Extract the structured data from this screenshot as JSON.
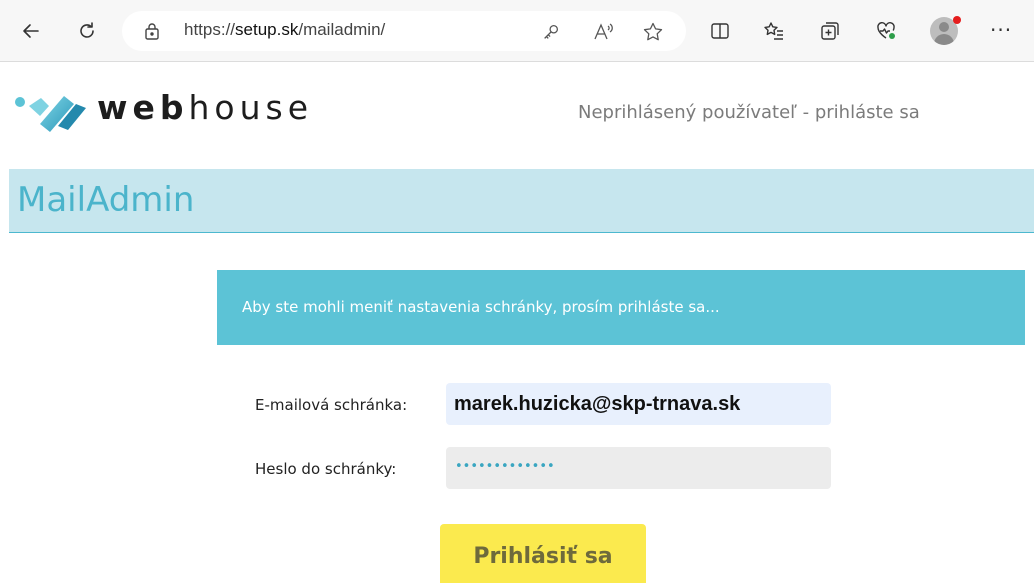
{
  "browser": {
    "url_prefix": "https://",
    "url_domain": "setup.sk",
    "url_path": "/mailadmin/",
    "more_label": "···"
  },
  "header": {
    "logo_bold": "web",
    "logo_light": "house",
    "user_status": "Neprihlásený používateľ - prihláste sa"
  },
  "app": {
    "title": "MailAdmin"
  },
  "notice": {
    "text": "Aby ste mohli meniť nastavenia schránky, prosím prihláste sa..."
  },
  "form": {
    "email_label": "E-mailová schránka:",
    "email_value": "marek.huzicka@skp-trnava.sk",
    "password_label": "Heslo do schránky:",
    "password_mask": "•••••••••••••",
    "submit_label": "Prihlásiť sa"
  },
  "colors": {
    "accent": "#4bb4cb",
    "banner_bg": "#c6e6ee",
    "notice_bg": "#5cc3d6",
    "button_bg": "#fbea4e",
    "email_bg": "#e8f0fd"
  }
}
